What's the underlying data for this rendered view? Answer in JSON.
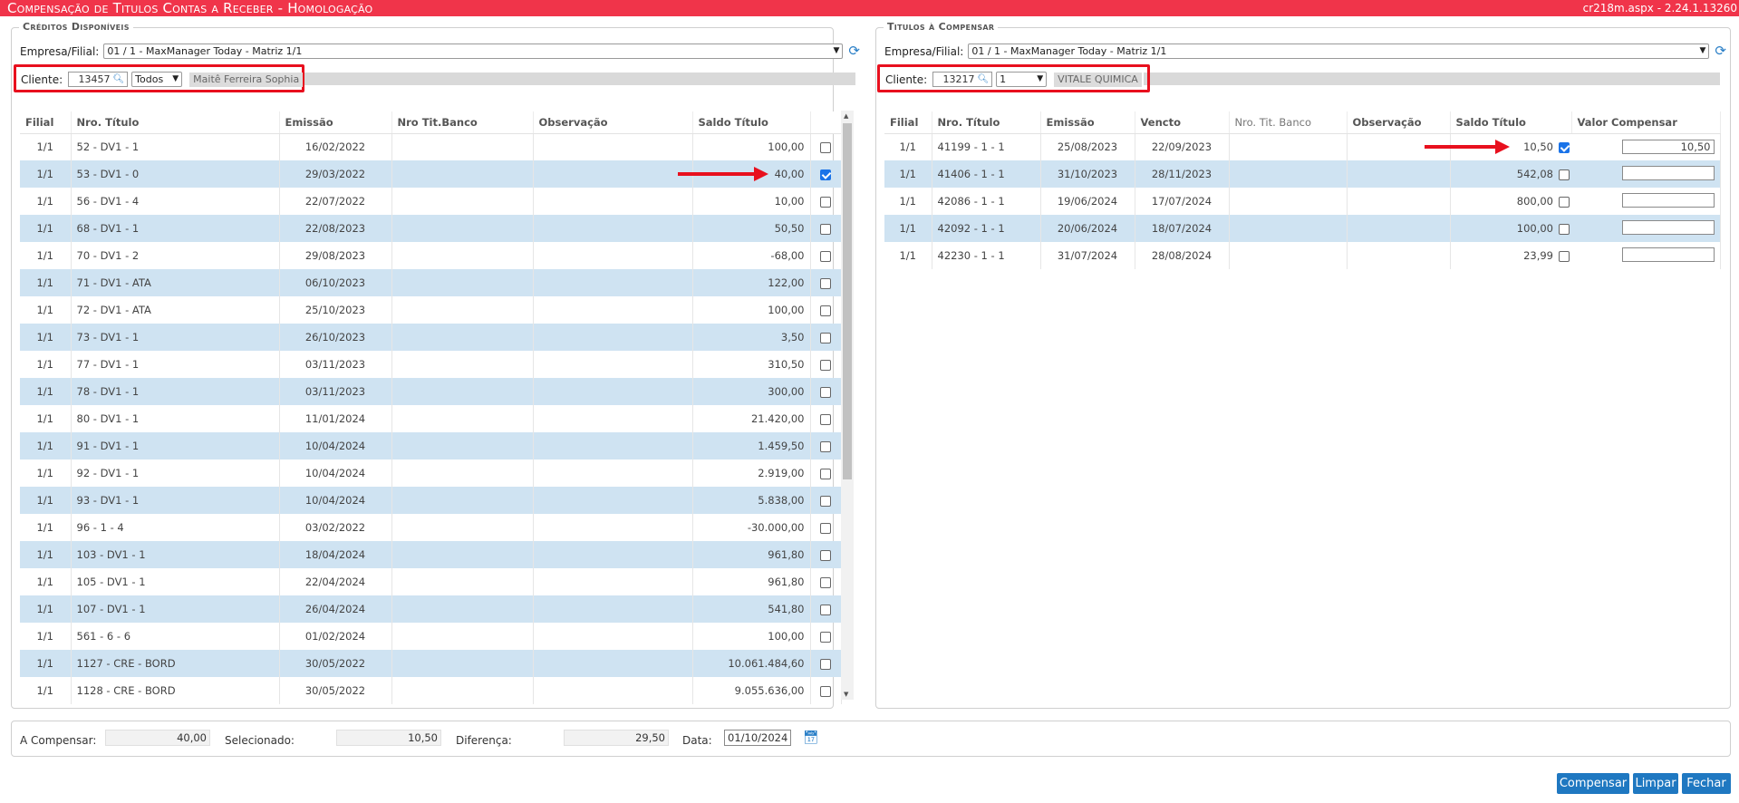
{
  "window": {
    "title": "Compensação de Titulos Contas a Receber",
    "environment": "- Homologação",
    "version": "cr218m.aspx - 2.24.1.13260"
  },
  "left": {
    "legend": "Créditos Disponíveis",
    "empresa_label": "Empresa/Filial:",
    "empresa_value": "01 / 1 - MaxManager Today - Matriz 1/1",
    "cliente_label": "Cliente:",
    "cliente_code": "13457",
    "filter_value": "Todos",
    "cliente_name": "Maitê Ferreira Sophia",
    "columns": [
      "Filial",
      "Nro. Título",
      "Emissão",
      "Nro Tit.Banco",
      "Observação",
      "Saldo Título"
    ],
    "rows": [
      {
        "filial": "1/1",
        "titulo": "52 - DV1 - 1",
        "emissao": "16/02/2022",
        "saldo": "100,00",
        "checked": false
      },
      {
        "filial": "1/1",
        "titulo": "53 - DV1 - 0",
        "emissao": "29/03/2022",
        "saldo": "40,00",
        "checked": true
      },
      {
        "filial": "1/1",
        "titulo": "56 - DV1 - 4",
        "emissao": "22/07/2022",
        "saldo": "10,00",
        "checked": false
      },
      {
        "filial": "1/1",
        "titulo": "68 - DV1 - 1",
        "emissao": "22/08/2023",
        "saldo": "50,50",
        "checked": false
      },
      {
        "filial": "1/1",
        "titulo": "70 - DV1 - 2",
        "emissao": "29/08/2023",
        "saldo": "-68,00",
        "checked": false
      },
      {
        "filial": "1/1",
        "titulo": "71 - DV1 - ATA",
        "emissao": "06/10/2023",
        "saldo": "122,00",
        "checked": false
      },
      {
        "filial": "1/1",
        "titulo": "72 - DV1 - ATA",
        "emissao": "25/10/2023",
        "saldo": "100,00",
        "checked": false
      },
      {
        "filial": "1/1",
        "titulo": "73 - DV1 - 1",
        "emissao": "26/10/2023",
        "saldo": "3,50",
        "checked": false
      },
      {
        "filial": "1/1",
        "titulo": "77 - DV1 - 1",
        "emissao": "03/11/2023",
        "saldo": "310,50",
        "checked": false
      },
      {
        "filial": "1/1",
        "titulo": "78 - DV1 - 1",
        "emissao": "03/11/2023",
        "saldo": "300,00",
        "checked": false
      },
      {
        "filial": "1/1",
        "titulo": "80 - DV1 - 1",
        "emissao": "11/01/2024",
        "saldo": "21.420,00",
        "checked": false
      },
      {
        "filial": "1/1",
        "titulo": "91 - DV1 - 1",
        "emissao": "10/04/2024",
        "saldo": "1.459,50",
        "checked": false
      },
      {
        "filial": "1/1",
        "titulo": "92 - DV1 - 1",
        "emissao": "10/04/2024",
        "saldo": "2.919,00",
        "checked": false
      },
      {
        "filial": "1/1",
        "titulo": "93 - DV1 - 1",
        "emissao": "10/04/2024",
        "saldo": "5.838,00",
        "checked": false
      },
      {
        "filial": "1/1",
        "titulo": "96 - 1 - 4",
        "emissao": "03/02/2022",
        "saldo": "-30.000,00",
        "checked": false
      },
      {
        "filial": "1/1",
        "titulo": "103 - DV1 - 1",
        "emissao": "18/04/2024",
        "saldo": "961,80",
        "checked": false
      },
      {
        "filial": "1/1",
        "titulo": "105 - DV1 - 1",
        "emissao": "22/04/2024",
        "saldo": "961,80",
        "checked": false
      },
      {
        "filial": "1/1",
        "titulo": "107 - DV1 - 1",
        "emissao": "26/04/2024",
        "saldo": "541,80",
        "checked": false
      },
      {
        "filial": "1/1",
        "titulo": "561 - 6 - 6",
        "emissao": "01/02/2024",
        "saldo": "100,00",
        "checked": false
      },
      {
        "filial": "1/1",
        "titulo": "1127 - CRE - BORD",
        "emissao": "30/05/2022",
        "saldo": "10.061.484,60",
        "checked": false
      },
      {
        "filial": "1/1",
        "titulo": "1128 - CRE - BORD",
        "emissao": "30/05/2022",
        "saldo": "9.055.636,00",
        "checked": false
      }
    ]
  },
  "right": {
    "legend": "Titulos à Compensar",
    "empresa_label": "Empresa/Filial:",
    "empresa_value": "01 / 1 - MaxManager Today - Matriz 1/1",
    "cliente_label": "Cliente:",
    "cliente_code": "13217",
    "filter_value": "1",
    "cliente_name": "VITALE QUIMICA",
    "columns": [
      "Filial",
      "Nro. Título",
      "Emissão",
      "Vencto",
      "Nro. Tit. Banco",
      "Observação",
      "Saldo Título",
      "Valor Compensar"
    ],
    "rows": [
      {
        "filial": "1/1",
        "titulo": "41199 - 1 - 1",
        "emissao": "25/08/2023",
        "vencto": "22/09/2023",
        "saldo": "10,50",
        "checked": true,
        "valor": "10,50"
      },
      {
        "filial": "1/1",
        "titulo": "41406 - 1 - 1",
        "emissao": "31/10/2023",
        "vencto": "28/11/2023",
        "saldo": "542,08",
        "checked": false,
        "valor": ""
      },
      {
        "filial": "1/1",
        "titulo": "42086 - 1 - 1",
        "emissao": "19/06/2024",
        "vencto": "17/07/2024",
        "saldo": "800,00",
        "checked": false,
        "valor": ""
      },
      {
        "filial": "1/1",
        "titulo": "42092 - 1 - 1",
        "emissao": "20/06/2024",
        "vencto": "18/07/2024",
        "saldo": "100,00",
        "checked": false,
        "valor": ""
      },
      {
        "filial": "1/1",
        "titulo": "42230 - 1 - 1",
        "emissao": "31/07/2024",
        "vencto": "28/08/2024",
        "saldo": "23,99",
        "checked": false,
        "valor": ""
      }
    ]
  },
  "footer": {
    "a_compensar_label": "A Compensar:",
    "a_compensar_value": "40,00",
    "selecionado_label": "Selecionado:",
    "selecionado_value": "10,50",
    "diferenca_label": "Diferença:",
    "diferenca_value": "29,50",
    "data_label": "Data:",
    "data_value": "01/10/2024"
  },
  "buttons": {
    "compensar": "Compensar",
    "limpar": "Limpar",
    "fechar": "Fechar"
  },
  "colors": {
    "titlebar": "#f0344a",
    "row_alt": "#cfe3f2",
    "button": "#1f78c1",
    "highlight": "#e8101e"
  },
  "icons": {
    "refresh": "refresh-icon",
    "search": "search-icon",
    "calendar": "calendar-icon"
  }
}
